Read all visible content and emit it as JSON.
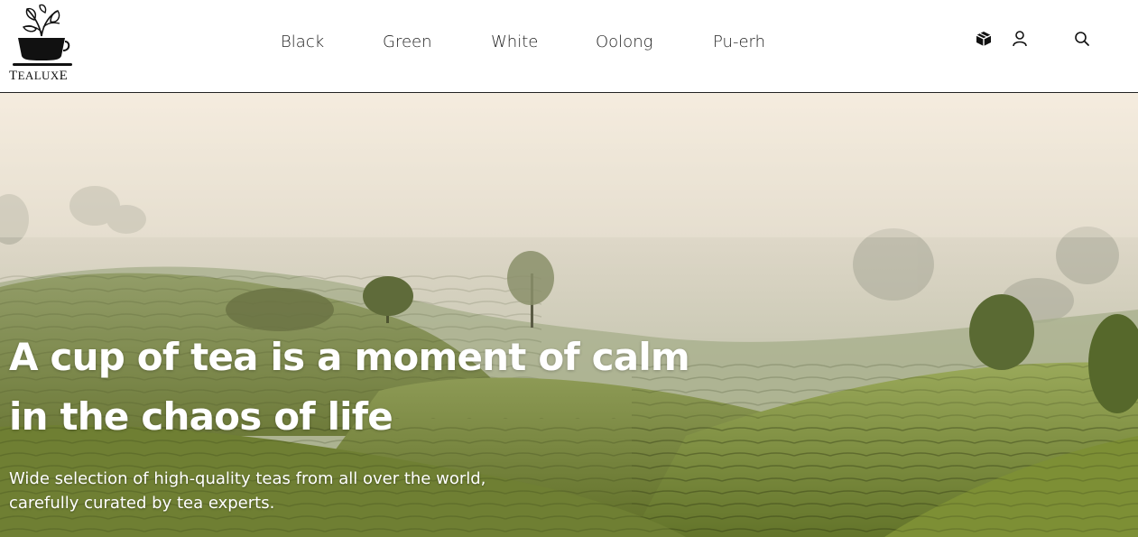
{
  "brand": {
    "name_first": "T",
    "name_middle": "EALUX",
    "name_last": "E",
    "logo_icon": "tea-cup-with-leaves-icon"
  },
  "nav": {
    "items": [
      {
        "label": "Black"
      },
      {
        "label": "Green"
      },
      {
        "label": "White"
      },
      {
        "label": "Oolong"
      },
      {
        "label": "Pu-erh"
      }
    ]
  },
  "header_icons": {
    "cart": "box-icon",
    "account": "user-icon",
    "search": "search-icon"
  },
  "hero": {
    "title_line1": "A cup of tea is a moment of calm",
    "title_line2": "in the chaos of life",
    "subtitle_line1": "Wide selection of high-quality teas from all over the world,",
    "subtitle_line2": "carefully curated by tea experts."
  },
  "colors": {
    "text": "#222222",
    "hero_text": "#ffffff",
    "header_bg": "#ffffff",
    "field_green": "#6d7c3a",
    "fog": "#e9e0d0"
  }
}
